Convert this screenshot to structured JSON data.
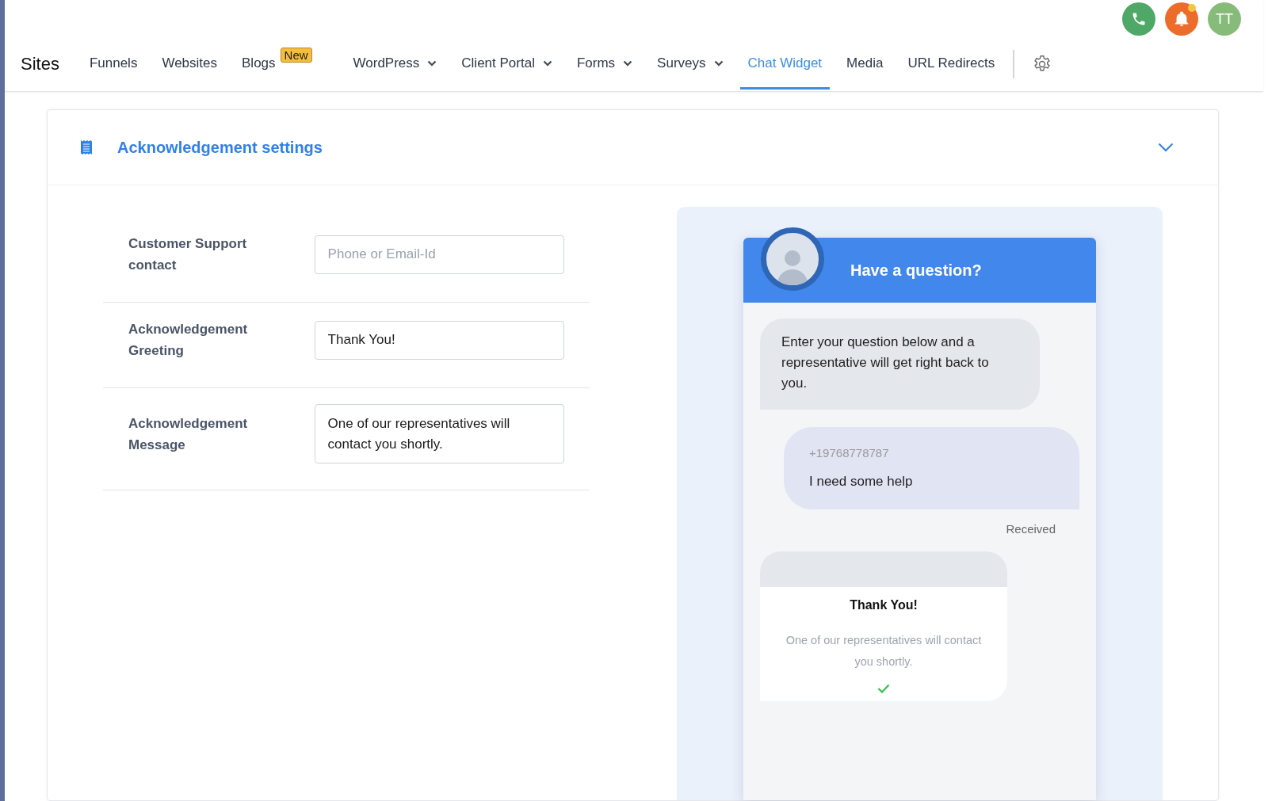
{
  "header": {
    "avatar_initials": "TT",
    "notification_unread": true
  },
  "nav": {
    "title": "Sites",
    "items": [
      {
        "label": "Funnels",
        "selected": false,
        "has_menu": false
      },
      {
        "label": "Websites",
        "selected": false,
        "has_menu": false
      },
      {
        "label": "Blogs",
        "selected": false,
        "has_menu": false,
        "badge": "New"
      },
      {
        "label": "WordPress",
        "selected": false,
        "has_menu": true
      },
      {
        "label": "Client Portal",
        "selected": false,
        "has_menu": true
      },
      {
        "label": "Forms",
        "selected": false,
        "has_menu": true
      },
      {
        "label": "Surveys",
        "selected": false,
        "has_menu": true
      },
      {
        "label": "Chat Widget",
        "selected": true,
        "has_menu": false
      },
      {
        "label": "Media",
        "selected": false,
        "has_menu": false
      },
      {
        "label": "URL Redirects",
        "selected": false,
        "has_menu": false
      }
    ]
  },
  "section": {
    "title": "Acknowledgement settings",
    "expanded": true
  },
  "fields": [
    {
      "kind": "input",
      "label": "Customer Support contact",
      "placeholder": "Phone or Email-Id"
    },
    {
      "kind": "input",
      "label": "Acknowledgement Greeting",
      "value": "Thank You!"
    },
    {
      "kind": "textarea",
      "label": "Acknowledgement Message",
      "value": "One of our representatives will contact you shortly."
    }
  ],
  "preview": {
    "title": "Have a question?",
    "intro": "Enter your question below and a representative will get right back to you.",
    "sender": "+19768778787",
    "message": "I need some help",
    "status": "Received",
    "ack_title": "Thank You!",
    "ack_message": "One of our representatives will contact you shortly."
  }
}
